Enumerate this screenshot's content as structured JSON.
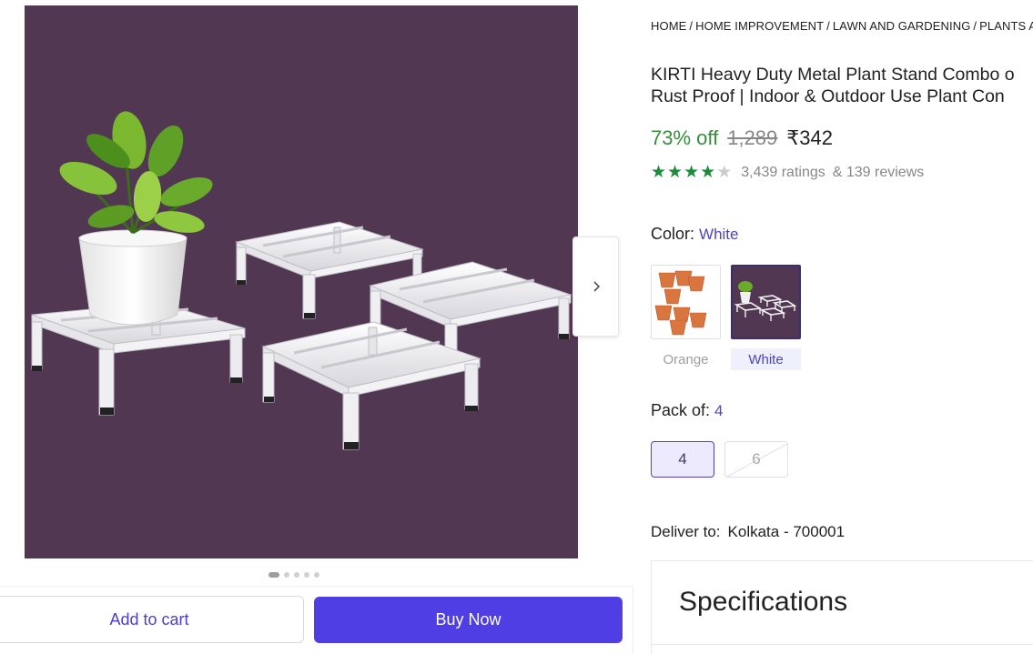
{
  "breadcrumb": [
    "HOME",
    "HOME IMPROVEMENT",
    "LAWN AND GARDENING",
    "PLANTS AN"
  ],
  "product": {
    "title_line1": "KIRTI Heavy Duty Metal Plant Stand Combo o",
    "title_line2": "Rust Proof | Indoor & Outdoor Use Plant Con"
  },
  "pricing": {
    "discount": "73% off",
    "mrp": "1,289",
    "price": "₹342"
  },
  "rating": {
    "stars_value": 4,
    "stars_max": 5,
    "ratings_text": "3,439 ratings",
    "reviews_text": "& 139 reviews"
  },
  "color": {
    "label": "Color:",
    "selected": "White",
    "options": [
      {
        "label": "Orange",
        "selected": false
      },
      {
        "label": "White",
        "selected": true
      }
    ]
  },
  "pack": {
    "label": "Pack of:",
    "selected": "4",
    "options": [
      {
        "label": "4",
        "selected": true,
        "available": true
      },
      {
        "label": "6",
        "selected": false,
        "available": false
      }
    ]
  },
  "delivery": {
    "label": "Deliver to:",
    "location": "Kolkata - 700001"
  },
  "specifications": {
    "title": "Specifications"
  },
  "actions": {
    "add_to_cart": "Add to cart",
    "buy_now": "Buy Now"
  },
  "gallery": {
    "image_count": 5,
    "active_index": 0,
    "background_color": "#523753"
  },
  "colors": {
    "accent": "#4f3ee3",
    "discount_green": "#388e3c",
    "star_green": "#1c8c3b",
    "link_purple": "#4b44c9"
  }
}
